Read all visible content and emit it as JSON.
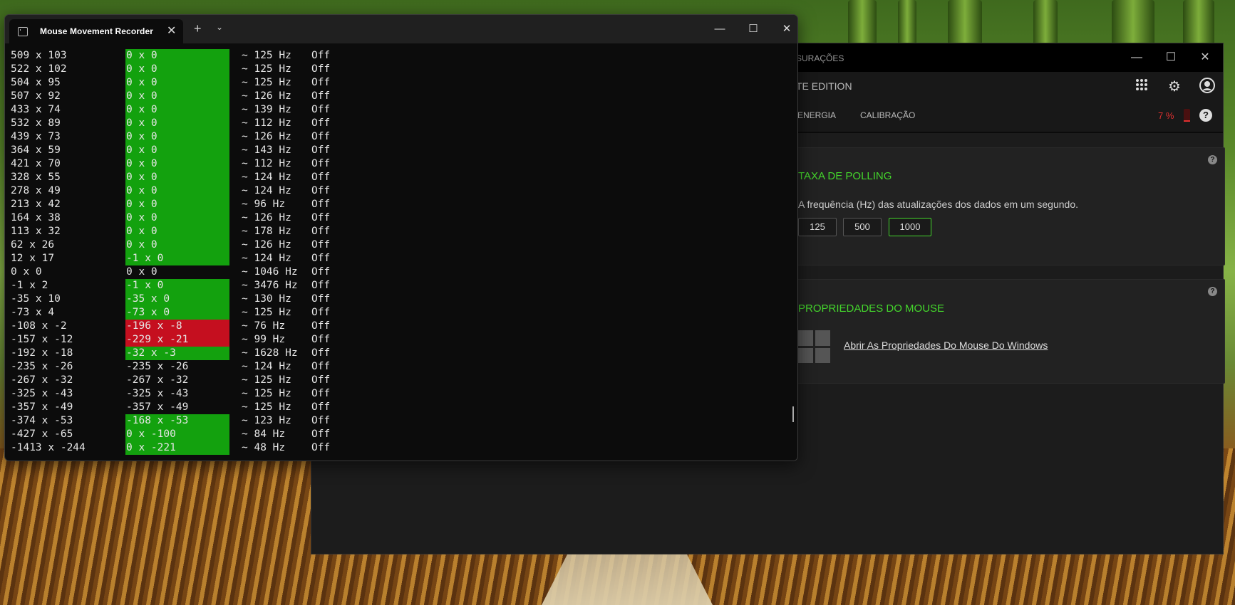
{
  "terminal": {
    "tab_title": "Mouse Movement Recorder",
    "rows": [
      {
        "abs": "509 x 103",
        "rel": "0 x 0",
        "hz": "~ 125 Hz",
        "state": "Off",
        "hl": "green"
      },
      {
        "abs": "522 x 102",
        "rel": "0 x 0",
        "hz": "~ 125 Hz",
        "state": "Off",
        "hl": "green"
      },
      {
        "abs": "504 x 95",
        "rel": "0 x 0",
        "hz": "~ 125 Hz",
        "state": "Off",
        "hl": "green"
      },
      {
        "abs": "507 x 92",
        "rel": "0 x 0",
        "hz": "~ 126 Hz",
        "state": "Off",
        "hl": "green"
      },
      {
        "abs": "433 x 74",
        "rel": "0 x 0",
        "hz": "~ 139 Hz",
        "state": "Off",
        "hl": "green"
      },
      {
        "abs": "532 x 89",
        "rel": "0 x 0",
        "hz": "~ 112 Hz",
        "state": "Off",
        "hl": "green"
      },
      {
        "abs": "439 x 73",
        "rel": "0 x 0",
        "hz": "~ 126 Hz",
        "state": "Off",
        "hl": "green"
      },
      {
        "abs": "364 x 59",
        "rel": "0 x 0",
        "hz": "~ 143 Hz",
        "state": "Off",
        "hl": "green"
      },
      {
        "abs": "421 x 70",
        "rel": "0 x 0",
        "hz": "~ 112 Hz",
        "state": "Off",
        "hl": "green"
      },
      {
        "abs": "328 x 55",
        "rel": "0 x 0",
        "hz": "~ 124 Hz",
        "state": "Off",
        "hl": "green"
      },
      {
        "abs": "278 x 49",
        "rel": "0 x 0",
        "hz": "~ 124 Hz",
        "state": "Off",
        "hl": "green"
      },
      {
        "abs": "213 x 42",
        "rel": "0 x 0",
        "hz": "~ 96 Hz",
        "state": "Off",
        "hl": "green"
      },
      {
        "abs": "164 x 38",
        "rel": "0 x 0",
        "hz": "~ 126 Hz",
        "state": "Off",
        "hl": "green"
      },
      {
        "abs": "113 x 32",
        "rel": "0 x 0",
        "hz": "~ 178 Hz",
        "state": "Off",
        "hl": "green"
      },
      {
        "abs": "62 x 26",
        "rel": "0 x 0",
        "hz": "~ 126 Hz",
        "state": "Off",
        "hl": "green"
      },
      {
        "abs": "12 x 17",
        "rel": "-1 x 0",
        "hz": "~ 124 Hz",
        "state": "Off",
        "hl": "green"
      },
      {
        "abs": "0 x 0",
        "rel": "0 x 0",
        "hz": "~ 1046 Hz",
        "state": "Off",
        "hl": "none"
      },
      {
        "abs": "-1 x 2",
        "rel": "-1 x 0",
        "hz": "~ 3476 Hz",
        "state": "Off",
        "hl": "green"
      },
      {
        "abs": "-35 x 10",
        "rel": "-35 x 0",
        "hz": "~ 130 Hz",
        "state": "Off",
        "hl": "green"
      },
      {
        "abs": "-73 x 4",
        "rel": "-73 x 0",
        "hz": "~ 125 Hz",
        "state": "Off",
        "hl": "green"
      },
      {
        "abs": "-108 x -2",
        "rel": "-196 x -8",
        "hz": "~ 76 Hz",
        "state": "Off",
        "hl": "red"
      },
      {
        "abs": "-157 x -12",
        "rel": "-229 x -21",
        "hz": "~ 99 Hz",
        "state": "Off",
        "hl": "red"
      },
      {
        "abs": "-192 x -18",
        "rel": "-32 x -3",
        "hz": "~ 1628 Hz",
        "state": "Off",
        "hl": "green"
      },
      {
        "abs": "-235 x -26",
        "rel": "-235 x -26",
        "hz": "~ 124 Hz",
        "state": "Off",
        "hl": "none"
      },
      {
        "abs": "-267 x -32",
        "rel": "-267 x -32",
        "hz": "~ 125 Hz",
        "state": "Off",
        "hl": "none"
      },
      {
        "abs": "-325 x -43",
        "rel": "-325 x -43",
        "hz": "~ 125 Hz",
        "state": "Off",
        "hl": "none"
      },
      {
        "abs": "-357 x -49",
        "rel": "-357 x -49",
        "hz": "~ 125 Hz",
        "state": "Off",
        "hl": "none"
      },
      {
        "abs": "-374 x -53",
        "rel": "-168 x -53",
        "hz": "~ 123 Hz",
        "state": "Off",
        "hl": "green"
      },
      {
        "abs": "-427 x -65",
        "rel": "0 x -100",
        "hz": "~ 84 Hz",
        "state": "Off",
        "hl": "green"
      },
      {
        "abs": "-1413 x -244",
        "rel": "0 x -221",
        "hz": "~ 48 Hz",
        "state": "Off",
        "hl": "green"
      }
    ]
  },
  "synapse": {
    "title_crumb": "SURAÇÕES",
    "edition": "TE EDITION",
    "tabs": [
      "ENERGIA",
      "CALIBRAÇÃO"
    ],
    "battery": "7 %",
    "polling": {
      "title": "TAXA DE POLLING",
      "description": "A frequência (Hz) das atualizações dos dados em um segundo.",
      "options": [
        "125",
        "500",
        "1000"
      ],
      "selected": "1000"
    },
    "mouse_props": {
      "title": "PROPRIEDADES DO MOUSE",
      "link": "Abrir As Propriedades Do Mouse Do Windows"
    }
  },
  "colors": {
    "razer_green": "#44d62c",
    "terminal_green": "#13a10e",
    "terminal_red": "#c50f1f"
  },
  "icons": [
    "terminal-tab-icon",
    "close-icon",
    "plus-icon",
    "chevron-down-icon",
    "minimize-icon",
    "maximize-icon",
    "apps-grid-icon",
    "gear-icon",
    "user-icon",
    "help-icon",
    "battery-icon",
    "windows-logo-icon"
  ]
}
